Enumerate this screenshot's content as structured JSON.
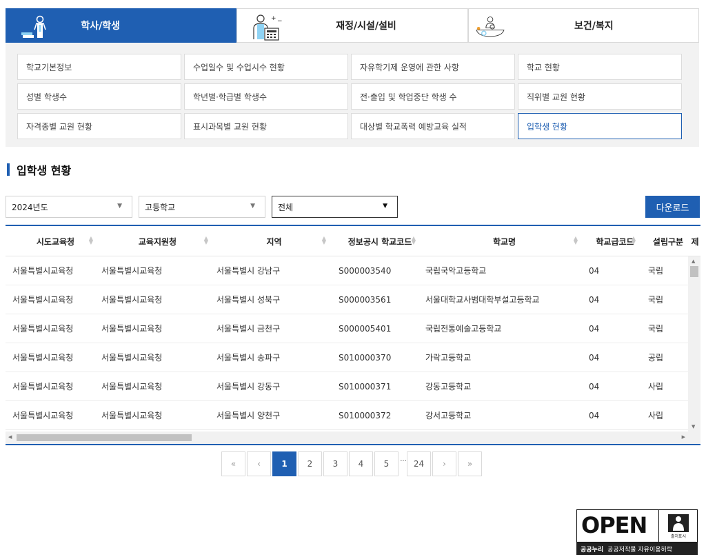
{
  "category_tabs": [
    {
      "label": "학사/학생",
      "icon": "student-icon",
      "active": true
    },
    {
      "label": "재정/시설/설비",
      "icon": "calculator-person-icon",
      "active": false
    },
    {
      "label": "보건/복지",
      "icon": "health-icon",
      "active": false
    }
  ],
  "submenu": [
    "학교기본정보",
    "수업일수 및 수업시수 현황",
    "자유학기제 운영에 관한 사항",
    "학교 현황",
    "성별 학생수",
    "학년별·학급별 학생수",
    "전·출입 및 학업중단 학생 수",
    "직위별 교원 현황",
    "자격종별 교원 현황",
    "표시과목별 교원 현황",
    "대상별 학교폭력 예방교육 실적",
    "입학생 현황"
  ],
  "submenu_active_index": 11,
  "page_title": "입학생 현황",
  "filters": {
    "year": "2024년도",
    "school_type": "고등학교",
    "scope": "전체"
  },
  "download_label": "다운로드",
  "table": {
    "headers": [
      "시도교육청",
      "교육지원청",
      "지역",
      "정보공시 학교코드",
      "학교명",
      "학교급코드",
      "설립구분",
      "제"
    ],
    "rows": [
      [
        "서울특별시교육청",
        "서울특별시교육청",
        "서울특별시 강남구",
        "S000003540",
        "국립국악고등학교",
        "04",
        "국립"
      ],
      [
        "서울특별시교육청",
        "서울특별시교육청",
        "서울특별시 성북구",
        "S000003561",
        "서울대학교사범대학부설고등학교",
        "04",
        "국립"
      ],
      [
        "서울특별시교육청",
        "서울특별시교육청",
        "서울특별시 금천구",
        "S000005401",
        "국립전통예술고등학교",
        "04",
        "국립"
      ],
      [
        "서울특별시교육청",
        "서울특별시교육청",
        "서울특별시 송파구",
        "S010000370",
        "가락고등학교",
        "04",
        "공립"
      ],
      [
        "서울특별시교육청",
        "서울특별시교육청",
        "서울특별시 강동구",
        "S010000371",
        "강동고등학교",
        "04",
        "사립"
      ],
      [
        "서울특별시교육청",
        "서울특별시교육청",
        "서울특별시 양천구",
        "S010000372",
        "강서고등학교",
        "04",
        "사립"
      ]
    ]
  },
  "pagination": {
    "first": "«",
    "prev": "‹",
    "pages": [
      "1",
      "2",
      "3",
      "4",
      "5"
    ],
    "ellipsis": "...",
    "last_page": "24",
    "next": "›",
    "last": "»",
    "current": "1"
  },
  "license": {
    "logo_text": "OPEN",
    "badge_label": "출처표시",
    "brand": "공공누리",
    "caption": "공공저작물 자유이용허락"
  },
  "colors": {
    "primary": "#1f5fb2",
    "submenu_bg": "#f2f2f2"
  }
}
